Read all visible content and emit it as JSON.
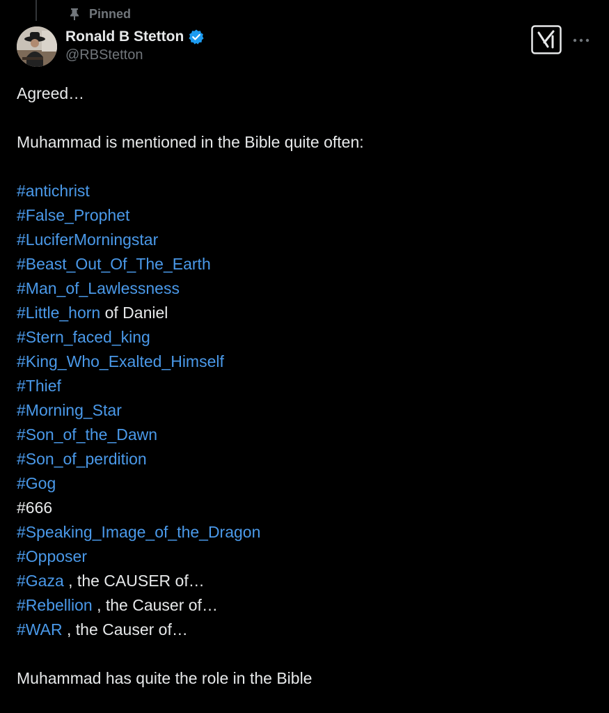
{
  "pinned_label": "Pinned",
  "author": {
    "display_name": "Ronald B Stetton",
    "handle": "@RBStetton",
    "verified": true
  },
  "icons": {
    "pin": "pin-icon",
    "verified": "verified-badge-icon",
    "grok": "grok-icon",
    "more": "more-icon"
  },
  "colors": {
    "background": "#000000",
    "text": "#e7e9ea",
    "muted": "#71767b",
    "hashtag": "#4a99e9",
    "verified": "#1d9bf0"
  },
  "tweet": {
    "intro": "Agreed…",
    "lead": "Muhammad is mentioned in the Bible quite often:",
    "hashtags": [
      {
        "tag": "#antichrist",
        "suffix": ""
      },
      {
        "tag": "#False_Prophet",
        "suffix": ""
      },
      {
        "tag": "#LuciferMorningstar",
        "suffix": ""
      },
      {
        "tag": "#Beast_Out_Of_The_Earth",
        "suffix": ""
      },
      {
        "tag": "#Man_of_Lawlessness",
        "suffix": ""
      },
      {
        "tag": "#Little_horn",
        "suffix": " of Daniel"
      },
      {
        "tag": "#Stern_faced_king",
        "suffix": ""
      },
      {
        "tag": "#King_Who_Exalted_Himself",
        "suffix": ""
      },
      {
        "tag": "#Thief",
        "suffix": ""
      },
      {
        "tag": "#Morning_Star",
        "suffix": ""
      },
      {
        "tag": "#Son_of_the_Dawn",
        "suffix": ""
      },
      {
        "tag": "#Son_of_perdition",
        "suffix": ""
      },
      {
        "tag": "#Gog",
        "suffix": ""
      }
    ],
    "plain_tag": "#666",
    "hashtags_2": [
      {
        "tag": "#Speaking_Image_of_the_Dragon",
        "suffix": ""
      },
      {
        "tag": "#Opposer",
        "suffix": ""
      },
      {
        "tag": "#Gaza",
        "suffix": " , the CAUSER of…"
      },
      {
        "tag": "#Rebellion",
        "suffix": " , the Causer of…"
      },
      {
        "tag": "#WAR",
        "suffix": " , the Causer of…"
      }
    ],
    "closing": "Muhammad has quite the role in the Bible"
  }
}
